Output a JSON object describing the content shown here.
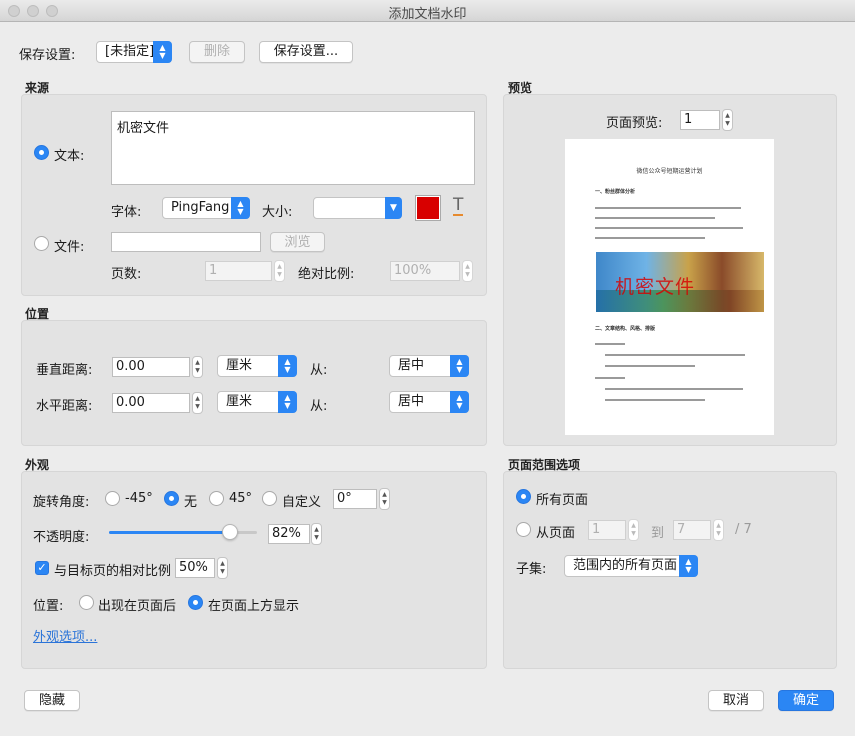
{
  "window": {
    "title": "添加文档水印"
  },
  "preset": {
    "label": "保存设置:",
    "value": "[未指定]",
    "delete_label": "删除",
    "save_label": "保存设置..."
  },
  "source": {
    "section": "来源",
    "text_label": "文本:",
    "text_value": "机密文件",
    "font_label": "字体:",
    "font_value": "PingFang",
    "size_label": "大小:",
    "color": "#d80000",
    "file_label": "文件:",
    "browse_label": "浏览",
    "page_label": "页数:",
    "page_value": "1",
    "scale_label": "绝对比例:",
    "scale_value": "100%"
  },
  "position": {
    "section": "位置",
    "vertical_label": "垂直距离:",
    "vertical_value": "0.00",
    "vertical_unit": "厘米",
    "vertical_from_label": "从:",
    "vertical_from": "居中",
    "horizontal_label": "水平距离:",
    "horizontal_value": "0.00",
    "horizontal_unit": "厘米",
    "horizontal_from_label": "从:",
    "horizontal_from": "居中"
  },
  "appearance": {
    "section": "外观",
    "rotation_label": "旋转角度:",
    "rot_neg45": "-45°",
    "rot_none": "无",
    "rot_45": "45°",
    "rot_custom": "自定义",
    "rot_custom_value": "0°",
    "opacity_label": "不透明度:",
    "opacity_value": "82%",
    "opacity_fraction": 0.82,
    "relative_label": "与目标页的相对比例",
    "relative_value": "50%",
    "placement_label": "位置:",
    "behind_label": "出现在页面后",
    "front_label": "在页面上方显示",
    "more_link": "外观选项..."
  },
  "preview": {
    "section": "预览",
    "page_label": "页面预览:",
    "page_value": "1",
    "doc_title": "微信公众号短期运营计划",
    "doc_h1": "一、粉丝群体分析",
    "doc_h2": "二、文章结构、风格、排版",
    "watermark": "机密文件"
  },
  "range": {
    "section": "页面范围选项",
    "all_label": "所有页面",
    "from_label": "从页面",
    "from_value": "1",
    "to_label": "到",
    "to_value": "7",
    "total": "/ 7",
    "subset_label": "子集:",
    "subset_value": "范围内的所有页面"
  },
  "footer": {
    "hide_label": "隐藏",
    "cancel_label": "取消",
    "ok_label": "确定"
  }
}
